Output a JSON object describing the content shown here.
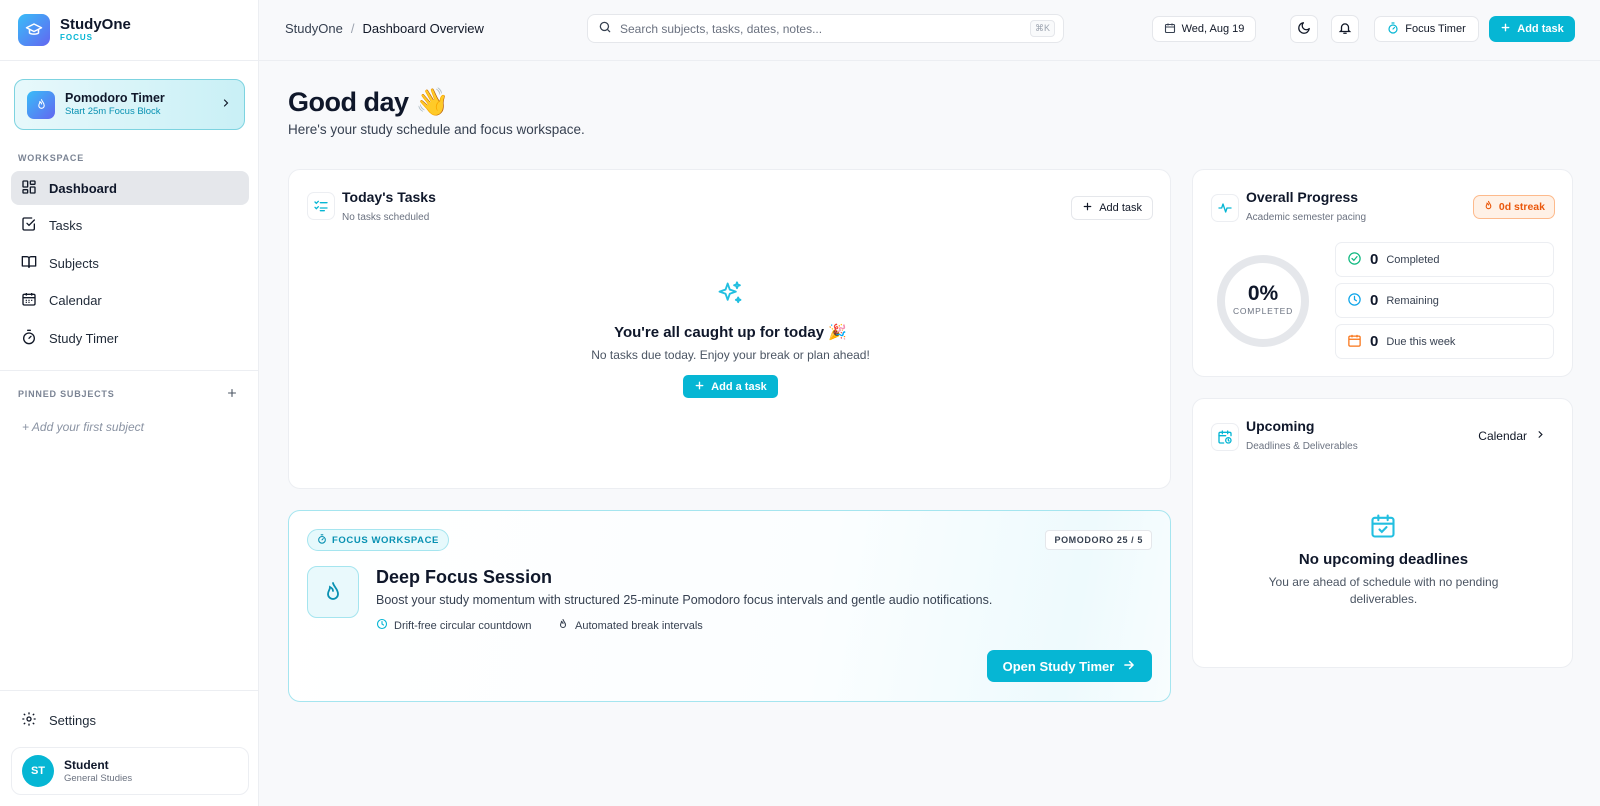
{
  "brand": {
    "name": "StudyOne",
    "sub": "FOCUS"
  },
  "sidebar": {
    "pomodoro": {
      "title": "Pomodoro Timer",
      "subtitle": "Start 25m Focus Block"
    },
    "workspace_label": "WORKSPACE",
    "items": [
      {
        "label": "Dashboard",
        "icon": "dashboard-icon",
        "active": true
      },
      {
        "label": "Tasks",
        "icon": "checkbox-icon"
      },
      {
        "label": "Subjects",
        "icon": "book-icon"
      },
      {
        "label": "Calendar",
        "icon": "calendar-icon"
      },
      {
        "label": "Study Timer",
        "icon": "timer-icon"
      }
    ],
    "pinned_label": "PINNED SUBJECTS",
    "add_subject": "+ Add your first subject",
    "settings": "Settings",
    "user": {
      "initials": "ST",
      "name": "Student",
      "program": "General Studies"
    }
  },
  "topbar": {
    "breadcrumb_root": "StudyOne",
    "breadcrumb_sep": "/",
    "breadcrumb_current": "Dashboard Overview",
    "search_placeholder": "Search subjects, tasks, dates, notes...",
    "search_shortcut": "⌘K",
    "date": "Wed, Aug 19",
    "focus_timer": "Focus Timer",
    "add_task": "Add task"
  },
  "main": {
    "greeting": "Good day 👋",
    "greeting_sub": "Here's your study schedule and focus workspace."
  },
  "tasks_card": {
    "title": "Today's Tasks",
    "subtitle": "No tasks scheduled",
    "add_button": "Add task",
    "empty_title": "You're all caught up for today 🎉",
    "empty_sub": "No tasks due today. Enjoy your break or plan ahead!",
    "empty_button": "Add a task"
  },
  "focus_card": {
    "pill": "FOCUS WORKSPACE",
    "tag": "POMODORO 25 / 5",
    "title": "Deep Focus Session",
    "description": "Boost your study momentum with structured 25-minute Pomodoro focus intervals and gentle audio notifications.",
    "feature_1": "Drift-free circular countdown",
    "feature_2": "Automated break intervals",
    "button": "Open Study Timer"
  },
  "progress_card": {
    "title": "Overall Progress",
    "subtitle": "Academic semester pacing",
    "streak": "0d streak",
    "percent_text": "0%",
    "percent_value": 0,
    "percent_label": "COMPLETED",
    "stats": [
      {
        "value": "0",
        "label": "Completed",
        "color": "#10b981"
      },
      {
        "value": "0",
        "label": "Remaining",
        "color": "#0ea5e9"
      },
      {
        "value": "0",
        "label": "Due this week",
        "color": "#f97316"
      }
    ]
  },
  "upcoming_card": {
    "title": "Upcoming",
    "subtitle": "Deadlines & Deliverables",
    "link": "Calendar",
    "empty_title": "No upcoming deadlines",
    "empty_sub": "You are ahead of schedule with no pending deliverables."
  },
  "colors": {
    "accent": "#06b6d4",
    "streak": "#ea580c"
  }
}
